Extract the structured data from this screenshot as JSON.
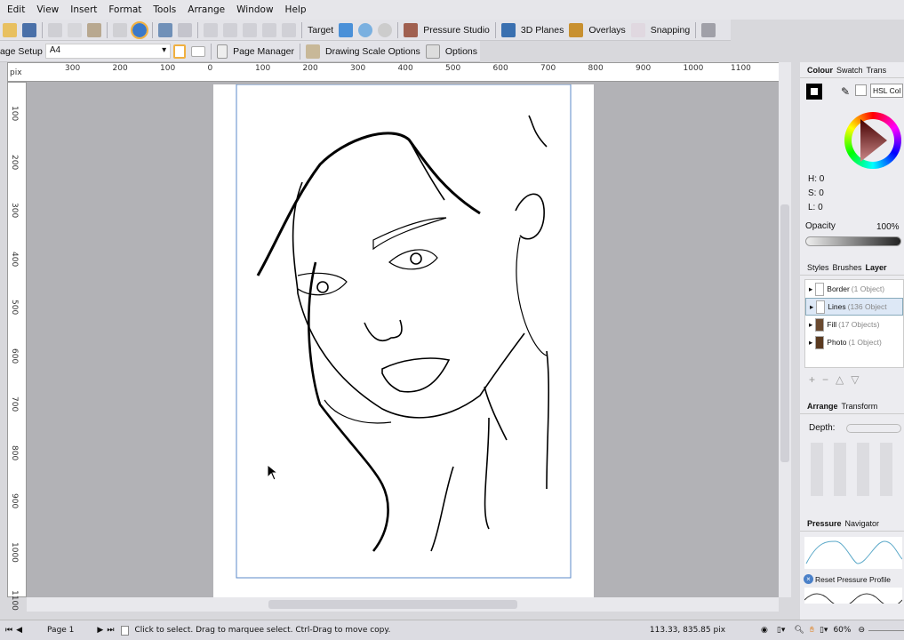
{
  "menu": [
    "Edit",
    "View",
    "Insert",
    "Format",
    "Tools",
    "Arrange",
    "Window",
    "Help"
  ],
  "toolbar": {
    "target": "Target",
    "pressure_studio": "Pressure Studio",
    "planes": "3D Planes",
    "overlays": "Overlays",
    "snapping": "Snapping"
  },
  "toolbar2": {
    "page_setup": "age Setup",
    "page_size": "A4",
    "page_manager": "Page Manager",
    "drawing_scale": "Drawing Scale Options",
    "options": "Options"
  },
  "ruler": {
    "unit": "pix",
    "h_ticks": [
      "300",
      "200",
      "100",
      "0",
      "100",
      "200",
      "300",
      "400",
      "500",
      "600",
      "700",
      "800",
      "900",
      "1000",
      "1100"
    ],
    "v_ticks": [
      "100",
      "200",
      "300",
      "400",
      "500",
      "600",
      "700",
      "800",
      "900",
      "1000",
      "1100"
    ]
  },
  "colour_panel": {
    "tabs": [
      "Colour",
      "Swatch",
      "Trans"
    ],
    "mode": "HSL Col",
    "h": "H: 0",
    "s": "S: 0",
    "l": "L: 0",
    "opacity_label": "Opacity",
    "opacity_value": "100%"
  },
  "layers_panel": {
    "tabs": [
      "Styles",
      "Brushes",
      "Layer"
    ],
    "layers": [
      {
        "name": "Border",
        "count": "(1 Object)"
      },
      {
        "name": "Lines",
        "count": "(136 Object"
      },
      {
        "name": "Fill",
        "count": "(17 Objects)"
      },
      {
        "name": "Photo",
        "count": "(1 Object)"
      }
    ]
  },
  "arrange_panel": {
    "tabs": [
      "Arrange",
      "Transform"
    ],
    "depth": "Depth:"
  },
  "pressure_panel": {
    "tabs": [
      "Pressure",
      "Navigator"
    ],
    "reset": "Reset Pressure Profile"
  },
  "status": {
    "page": "Page 1",
    "hint": "Click to select. Drag to marquee select. Ctrl-Drag to move copy.",
    "coords": "113.33, 835.85 pix",
    "zoom": "60%"
  }
}
